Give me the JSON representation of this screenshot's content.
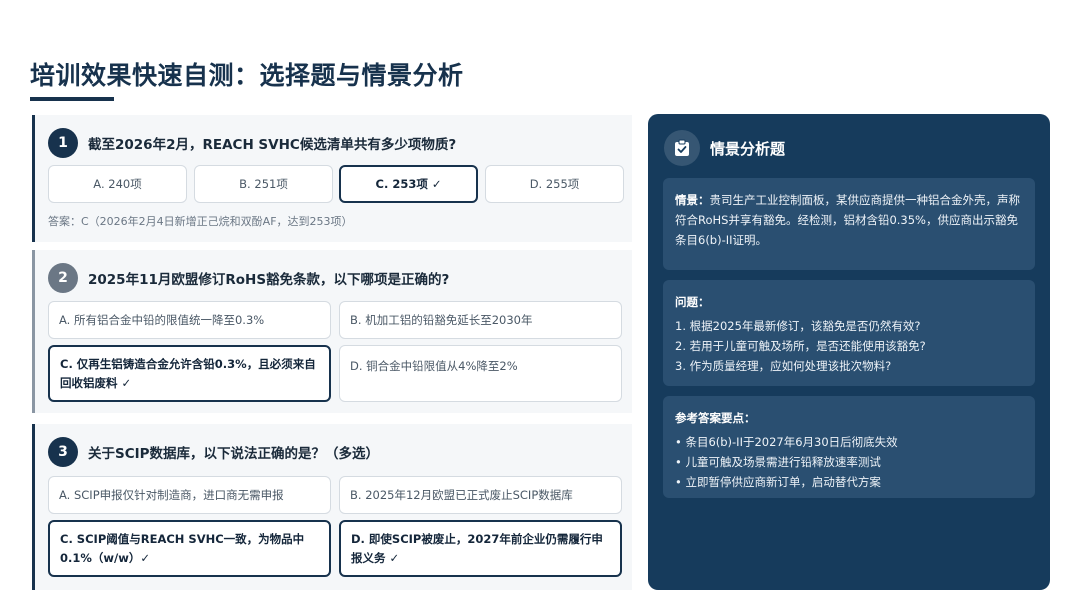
{
  "title": "培训效果快速自测：选择题与情景分析",
  "questions": [
    {
      "num": "1",
      "text": "截至2026年2月，REACH SVHC候选清单共有多少项物质?",
      "options": [
        "A. 240项",
        "B. 251项",
        "C. 253项 ✓",
        "D. 255项"
      ],
      "correct": [
        "C"
      ],
      "answer": "答案：C（2026年2月4日新增正己烷和双酚AF，达到253项）"
    },
    {
      "num": "2",
      "text": "2025年11月欧盟修订RoHS豁免条款，以下哪项是正确的?",
      "options": [
        "A. 所有铝合金中铅的限值统一降至0.3%",
        "B. 机加工铝的铅豁免延长至2030年",
        "C. 仅再生铝铸造合金允许含铅0.3%，且必须来自回收铝废料 ✓",
        "D. 铜合金中铅限值从4%降至2%"
      ],
      "correct": [
        "C"
      ]
    },
    {
      "num": "3",
      "text": "关于SCIP数据库，以下说法正确的是？（多选）",
      "options": [
        "A. SCIP申报仅针对制造商，进口商无需申报",
        "B. 2025年12月欧盟已正式废止SCIP数据库",
        "C. SCIP阈值与REACH SVHC一致，为物品中0.1%（w/w）✓",
        "D. 即使SCIP被废止，2027年前企业仍需履行申报义务 ✓"
      ],
      "correct": [
        "C",
        "D"
      ]
    }
  ],
  "scenario": {
    "icon": "clipboard-icon",
    "title": "情景分析题",
    "context_label": "情景：",
    "context_text": "贵司生产工业控制面板，某供应商提供一种铝合金外壳，声称符合RoHS并享有豁免。经检测，铝材含铅0.35%，供应商出示豁免条目6(b)-II证明。",
    "questions_title": "问题：",
    "questions": [
      "1. 根据2025年最新修订，该豁免是否仍然有效?",
      "2. 若用于儿童可触及场所，是否还能使用该豁免?",
      "3. 作为质量经理，应如何处理该批次物料?"
    ],
    "answers_title": "参考答案要点：",
    "answers": [
      "• 条目6(b)-II于2027年6月30日后彻底失效",
      "• 儿童可触及场景需进行铅释放速率测试",
      "• 立即暂停供应商新订单，启动替代方案"
    ]
  },
  "colors": {
    "navy": "#17324d",
    "panel": "#163b5c",
    "card": "#2a4f71"
  }
}
